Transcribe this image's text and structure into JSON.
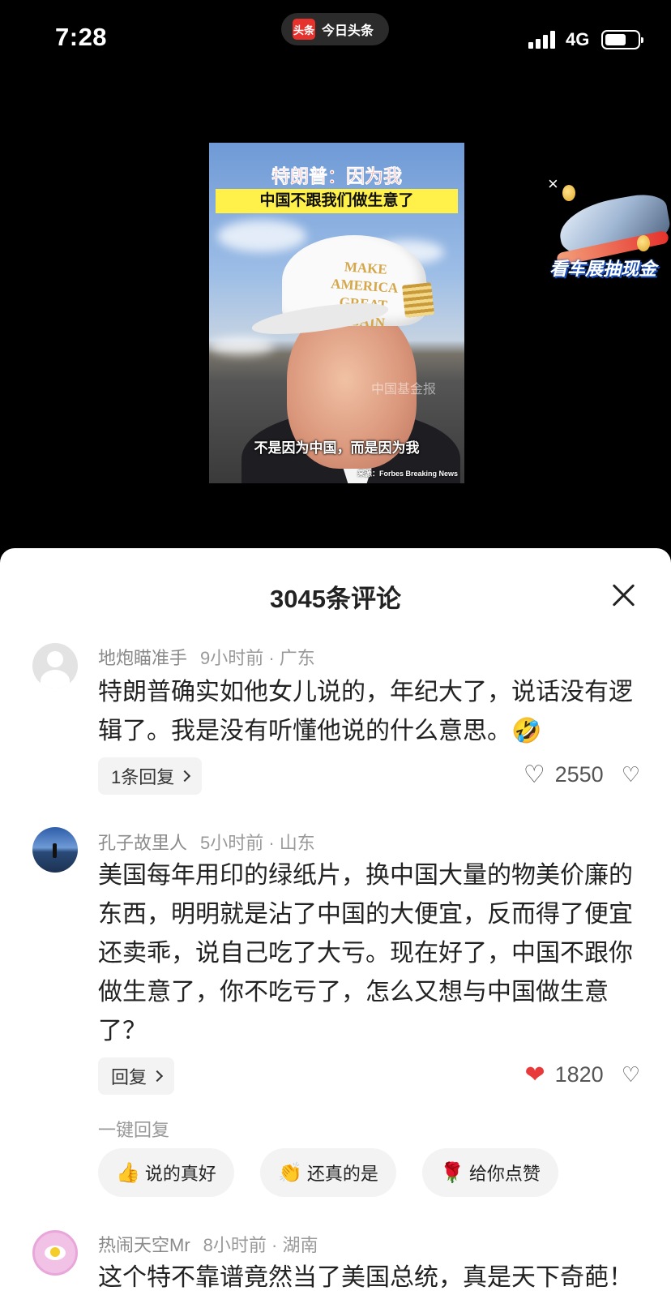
{
  "status_bar": {
    "time": "7:28",
    "app_name": "今日头条",
    "app_logo": "头条",
    "network": "4G"
  },
  "video": {
    "title": "特朗普：因为我",
    "subtitle": "中国不跟我们做生意了",
    "cap_text": "MAKE AMERICA GREAT AGAIN",
    "watermark": "中国基金报",
    "caption": "不是因为中国，而是因为我",
    "source": "来源：Forbes Breaking News"
  },
  "ad": {
    "close_label": "×",
    "text": "看车展抽现金"
  },
  "comments_panel": {
    "title": "3045条评论",
    "close_icon": "close-icon",
    "comments": [
      {
        "name": "地炮瞄准手",
        "meta": "9小时前 · 广东",
        "text": "特朗普确实如他女儿说的，年纪大了，说话没有逻辑了。我是没有听懂他说的什么意思。🤣",
        "reply_label": "1条回复",
        "likes": "2550",
        "liked": false
      },
      {
        "name": "孔子故里人",
        "meta": "5小时前 · 山东",
        "text": "美国每年用印的绿纸片，换中国大量的物美价廉的东西，明明就是沾了中国的大便宜，反而得了便宜还卖乖，说自己吃了大亏。现在好了，中国不跟你做生意了，你不吃亏了，怎么又想与中国做生意了？",
        "reply_label": "回复",
        "likes": "1820",
        "liked": true
      },
      {
        "name": "热闹天空Mr",
        "meta": "8小时前 · 湖南",
        "text": "这个特不靠谱竟然当了美国总统，真是天下奇葩！"
      }
    ],
    "quick_reply": {
      "label": "一键回复",
      "chips": [
        {
          "emoji": "👍",
          "text": "说的真好"
        },
        {
          "emoji": "👏",
          "text": "还真的是"
        },
        {
          "emoji": "🌹",
          "text": "给你点赞"
        }
      ]
    }
  },
  "colors": {
    "accent_red": "#e83a3a",
    "brand_red": "#e5322d",
    "meta_gray": "#999999"
  }
}
